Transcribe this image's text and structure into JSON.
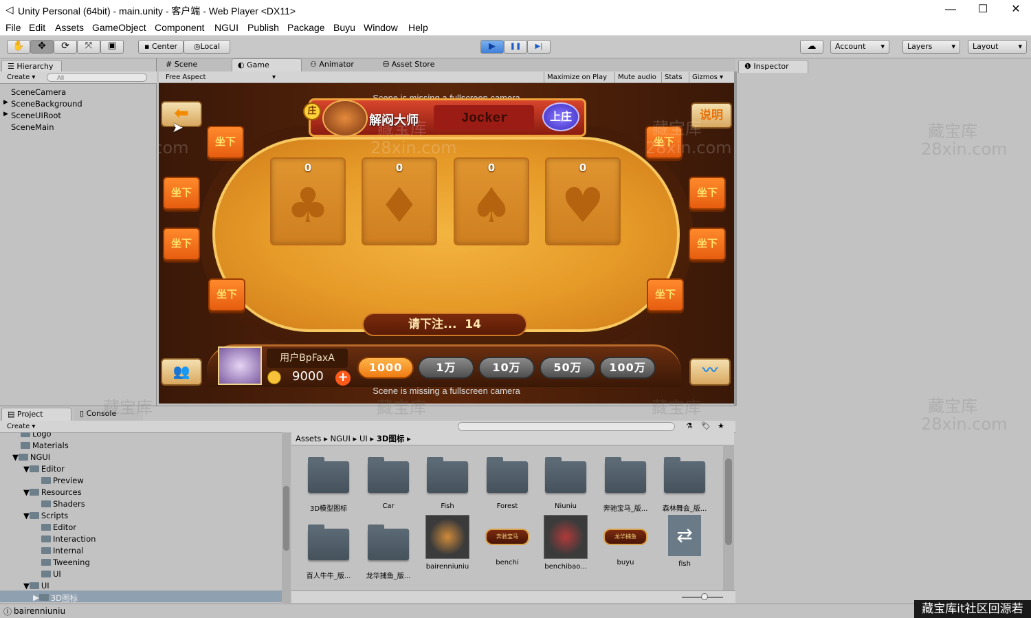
{
  "window": {
    "title": "Unity Personal (64bit) - main.unity - 客户端 - Web Player <DX11>",
    "minimize": "—",
    "maximize": "☐",
    "close": "✕"
  },
  "menu": [
    "File",
    "Edit",
    "Assets",
    "GameObject",
    "Component",
    "NGUI",
    "Publish",
    "Package",
    "Buyu",
    "Window",
    "Help"
  ],
  "toolbar": {
    "center": "Center",
    "local": "Local",
    "play": "▶",
    "pause": "❚❚",
    "step": "▶|",
    "account": "Account",
    "layers": "Layers",
    "layout": "Layout",
    "cloud": "☁"
  },
  "hierarchy": {
    "tab": "Hierarchy",
    "create": "Create",
    "search_placeholder": "All",
    "items": [
      "SceneCamera",
      "SceneBackground",
      "SceneUIRoot",
      "SceneMain"
    ]
  },
  "scene_tabs": {
    "scene": "Scene",
    "game": "Game",
    "animator": "Animator",
    "asset_store": "Asset Store"
  },
  "game_bar": {
    "aspect": "Free Aspect",
    "maximize": "Maximize on Play",
    "mute": "Mute audio",
    "stats": "Stats",
    "gizmos": "Gizmos"
  },
  "inspector": {
    "tab": "Inspector"
  },
  "game": {
    "missing_camera_top": "Scene is missing a fullscreen camera",
    "missing_camera_bottom": "Scene is missing a fullscreen camera",
    "banker_badge": "庄",
    "banker_name": "解闷大师",
    "banker_id": "Jocker",
    "become_banker": "上庄",
    "help": "说明",
    "slots": [
      {
        "value": "0",
        "suit": "♣"
      },
      {
        "value": "0",
        "suit": "♦"
      },
      {
        "value": "0",
        "suit": "♠"
      },
      {
        "value": "0",
        "suit": "♥"
      }
    ],
    "seat_label": "坐下",
    "bet_prompt": "请下注...",
    "countdown": "14",
    "player_name": "用户BpFaxA",
    "player_coins": "9000",
    "chips": [
      "1000",
      "1万",
      "10万",
      "50万",
      "100万"
    ],
    "watermark_cn": "藏宝库",
    "watermark_en": "28xin.com"
  },
  "project": {
    "tab_project": "Project",
    "tab_console": "Console",
    "create": "Create",
    "tree": [
      "Logo",
      "Materials",
      "NGUI",
      "Editor",
      "Preview",
      "Resources",
      "Shaders",
      "Scripts",
      "Editor",
      "Interaction",
      "Internal",
      "Tweening",
      "UI",
      "UI",
      "3D图标"
    ],
    "breadcrumb": [
      "Assets",
      "NGUI",
      "UI",
      "3D图标"
    ],
    "assets_row1": [
      "3D模型图标",
      "Car",
      "Fish",
      "Forest",
      "Niuniu",
      "奔驰宝马_版...",
      "森林舞会_版..."
    ],
    "assets_row2": [
      "百人牛牛_版...",
      "龙华捕鱼_版...",
      "bairenniuniu",
      "benchi",
      "benchibao...",
      "buyu",
      "fish"
    ],
    "benchi_thumb": "奔驰宝马",
    "buyu_thumb": "龙华捕鱼"
  },
  "status": {
    "message": "bairenniuniu",
    "corner": "藏宝库it社区回源若"
  }
}
